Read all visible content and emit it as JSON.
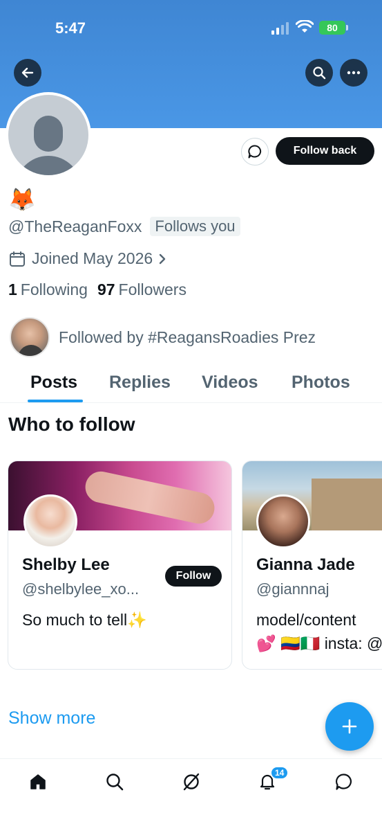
{
  "status_bar": {
    "time": "5:47",
    "battery": "80"
  },
  "profile": {
    "display_name": "🦊",
    "handle": "@TheReaganFoxx",
    "follows_you": "Follows you",
    "joined": "Joined May 2026",
    "following_count": "1",
    "following_label": "Following",
    "followers_count": "97",
    "followers_label": "Followers",
    "followed_by": "Followed by #ReagansRoadies Prez"
  },
  "actions": {
    "follow_back": "Follow back"
  },
  "tabs": [
    {
      "label": "Posts",
      "active": true
    },
    {
      "label": "Replies",
      "active": false
    },
    {
      "label": "Videos",
      "active": false
    },
    {
      "label": "Photos",
      "active": false
    }
  ],
  "who_to_follow": {
    "title": "Who to follow",
    "cards": [
      {
        "name": "Shelby Lee",
        "handle": "@shelbylee_xo...",
        "bio": "So much to tell✨",
        "follow_label": "Follow"
      },
      {
        "name": "Gianna Jade",
        "handle": "@giannnaj",
        "bio_line1": "model/content",
        "bio_line2": "💕 🇨🇴🇮🇹 insta: @"
      }
    ],
    "show_more": "Show more"
  },
  "nav": {
    "notifications_badge": "14"
  },
  "colors": {
    "accent": "#1d9bf0",
    "banner": "#4a97e6",
    "text": "#0f1419",
    "muted": "#536471"
  }
}
